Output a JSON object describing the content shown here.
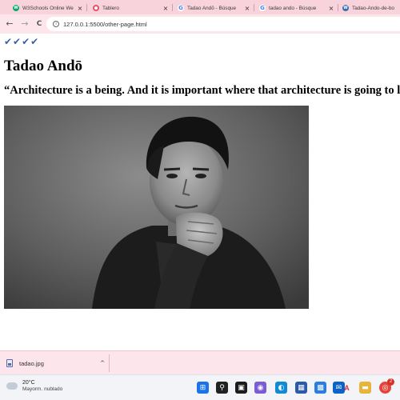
{
  "browser": {
    "tabs": [
      {
        "title": "W3Schools Online We",
        "close": "×",
        "favicon_letter": "W",
        "favicon_color": "#04aa6d",
        "active": false
      },
      {
        "title": "Tablero",
        "close": "×",
        "favicon_letter": "",
        "favicon_color": "#e0546a",
        "active": false
      },
      {
        "title": "Tadao Andō - Búsque",
        "close": "×",
        "favicon_letter": "G",
        "favicon_color": "#4285f4",
        "active": false
      },
      {
        "title": "tadao ando - Búsque",
        "close": "×",
        "favicon_letter": "G",
        "favicon_color": "#4285f4",
        "active": false
      },
      {
        "title": "Tadao-Ando-de-bo",
        "close": "",
        "favicon_letter": "W",
        "favicon_color": "#3b6fb6",
        "active": false
      }
    ],
    "nav": {
      "back": "←",
      "forward": "→",
      "reload": "C"
    },
    "address": {
      "url": "127.0.0.1:5500/other-page.html",
      "info_icon": "i"
    }
  },
  "page": {
    "checkmarks": "✔✔✔✔",
    "heading": "Tadao Andō",
    "quote": "“Architecture is a being. And it is important where that architecture is going to live.”"
  },
  "downloads": {
    "file_name": "tadao.jpg",
    "caret": "^"
  },
  "taskbar": {
    "weather_temp": "20°C",
    "weather_desc": "Mayorm. nublado",
    "icons": [
      {
        "name": "windows-start-icon",
        "color": "#1a73e8",
        "glyph": "⊞"
      },
      {
        "name": "search-icon",
        "color": "#222222",
        "glyph": "⚲"
      },
      {
        "name": "file-explorer-icon",
        "color": "#1c1c1c",
        "glyph": "▣"
      },
      {
        "name": "video-call-icon",
        "color": "#7b5cd6",
        "glyph": "◉"
      },
      {
        "name": "edge-browser-icon",
        "color": "#0f8bd6",
        "glyph": "◐"
      },
      {
        "name": "store-icon",
        "color": "#2b5aa8",
        "glyph": "▦"
      },
      {
        "name": "photos-icon",
        "color": "#2b7de0",
        "glyph": "▩"
      },
      {
        "name": "mail-icon",
        "color": "#0b63c7",
        "glyph": "✉"
      },
      {
        "name": "adobe-icon",
        "color": "#e03131",
        "glyph": "A"
      },
      {
        "name": "folder-icon",
        "color": "#e8b53b",
        "glyph": "▬"
      },
      {
        "name": "chrome-icon",
        "color": "#e5443a",
        "glyph": "◎"
      }
    ],
    "notification_count": "2"
  }
}
